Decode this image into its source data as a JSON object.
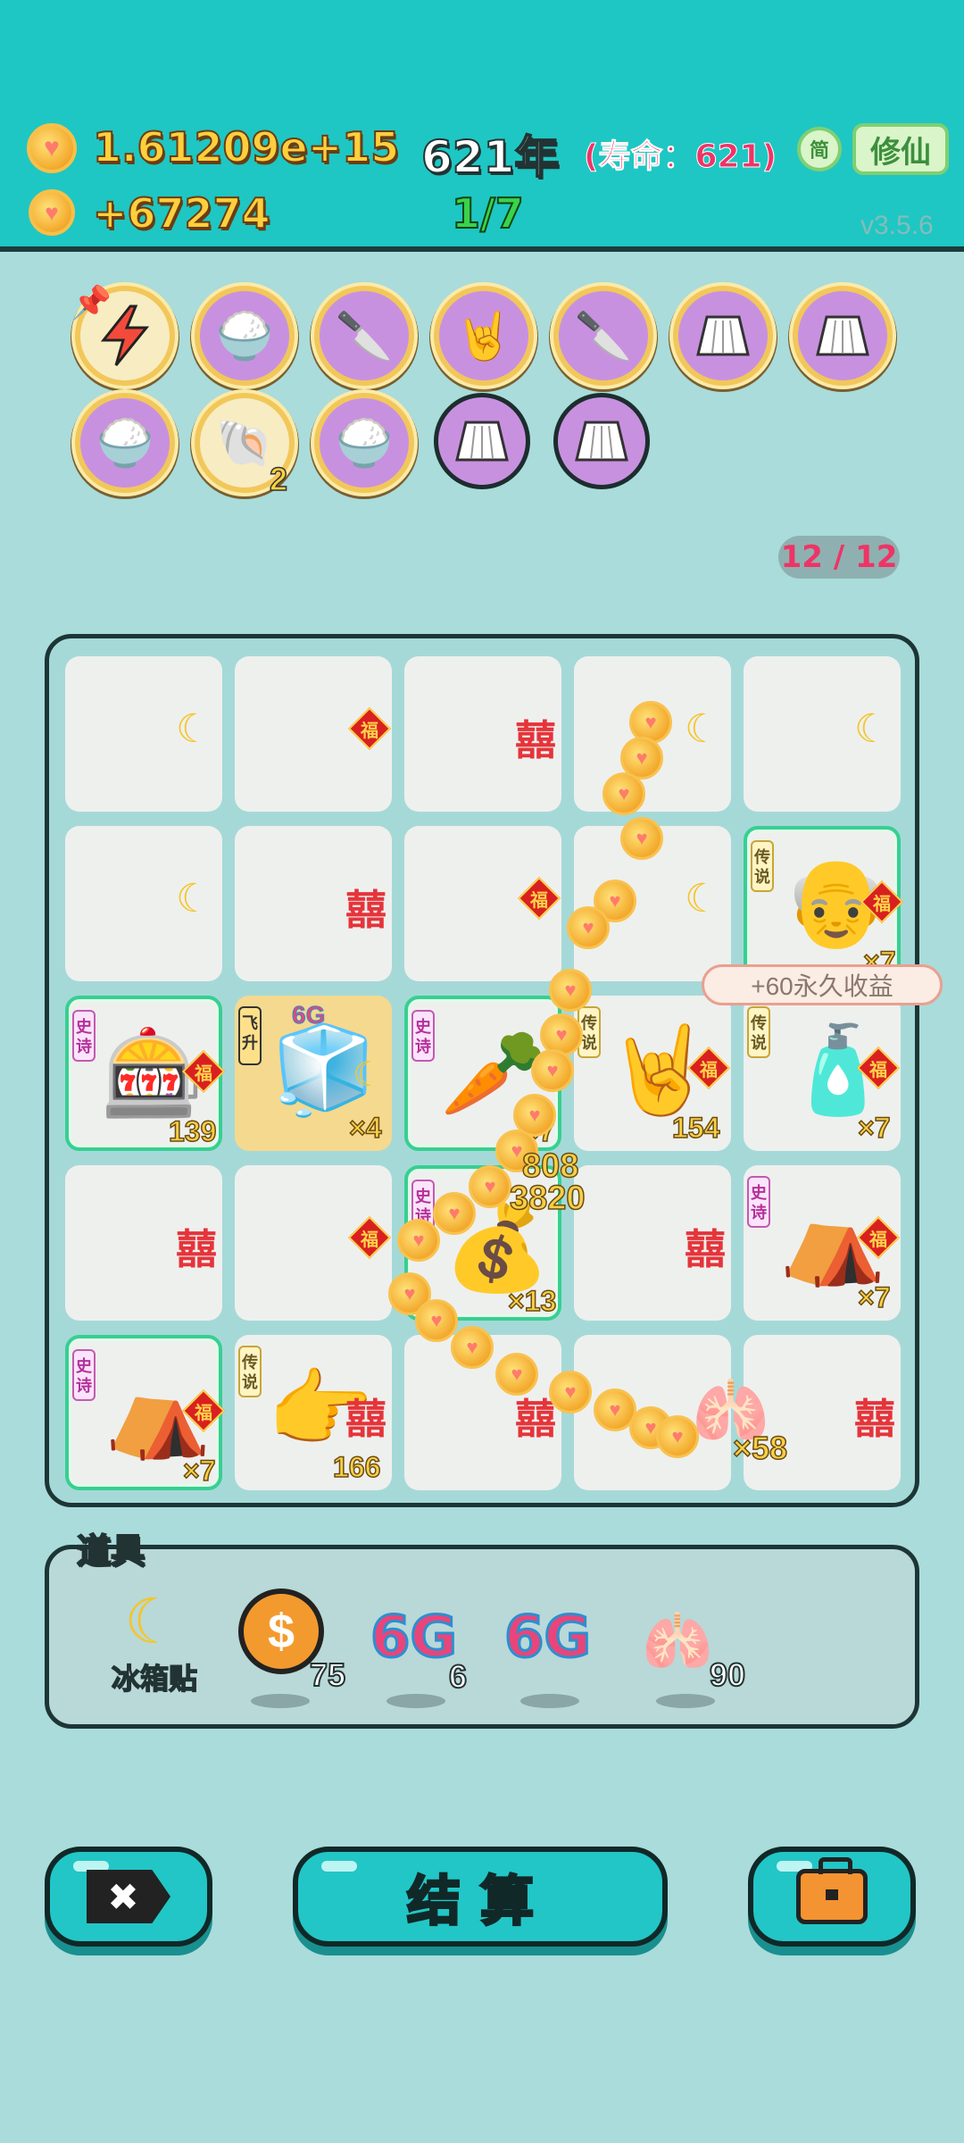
{
  "header": {
    "total_coins": "1.61209e+15",
    "income_rate": "+67274",
    "year": "621年",
    "lifespan": "(寿命：621)",
    "stage": "1/7",
    "simplified_toggle": "简",
    "cultivate_button": "修仙",
    "version": "v3.5.6"
  },
  "buffs": {
    "row1": [
      "lightning-icon",
      "rice-bowls-icon",
      "cleaver-icon",
      "rock-hand-icon",
      "cleaver-icon",
      "skirt-icon",
      "skirt-icon"
    ],
    "row2": [
      "rice-bowls-icon",
      "shell-icon",
      "rice-bowls-icon",
      "skirt-icon",
      "skirt-icon"
    ],
    "shell_count": "2"
  },
  "slots": "12 / 12",
  "board": {
    "fu_char": "福",
    "xi_char": "囍",
    "tag_epic": "史诗",
    "tag_legend": "传说",
    "tag_fly": "飞升",
    "sixg_label": "6G",
    "counts": {
      "claw_machine": "139",
      "fridge": "×4",
      "carrot": "×7",
      "rock_hand": "154",
      "bottle": "×7",
      "old_man": "×7",
      "coin_pile": "×13",
      "tent_r4": "×7",
      "tent_r5": "×7",
      "pointing_hand": "166",
      "liver": "×58"
    },
    "floating_label": "+60永久收益",
    "damage_1": "808",
    "damage_2": "3820"
  },
  "tools": {
    "title": "道具",
    "fridge_sticker_label": "冰箱贴",
    "dollar_coin_count": "75",
    "sixg_a_label": "6G",
    "sixg_a_count": "6",
    "sixg_b_label": "6G",
    "liver_count": "90"
  },
  "buttons": {
    "settle": "结算"
  },
  "colors": {
    "header_bg": "#1ec7c3",
    "page_bg": "#a9dcdb",
    "gold": "#ffcf3d",
    "lifespan_red": "#ee3466",
    "stage_green": "#3ad34c"
  }
}
